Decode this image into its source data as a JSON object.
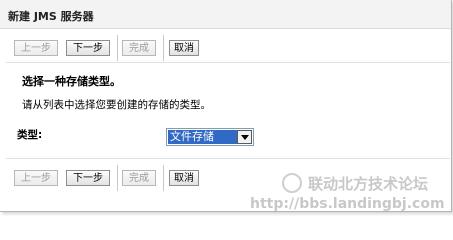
{
  "window": {
    "title": "新建 JMS 服务器"
  },
  "toolbar_top": {
    "back_label": "上一步",
    "next_label": "下一步",
    "finish_label": "完成",
    "cancel_label": "取消"
  },
  "content": {
    "heading": "选择一种存储类型。",
    "description": "请从列表中选择您要创建的存储的类型。",
    "type_label": "类型:",
    "type_select": {
      "selected": "文件存储"
    }
  },
  "toolbar_bottom": {
    "back_label": "上一步",
    "next_label": "下一步",
    "finish_label": "完成",
    "cancel_label": "取消"
  },
  "watermark": {
    "brand": "联动北方技术论坛",
    "url": "http://bbs.landingbj.com"
  }
}
